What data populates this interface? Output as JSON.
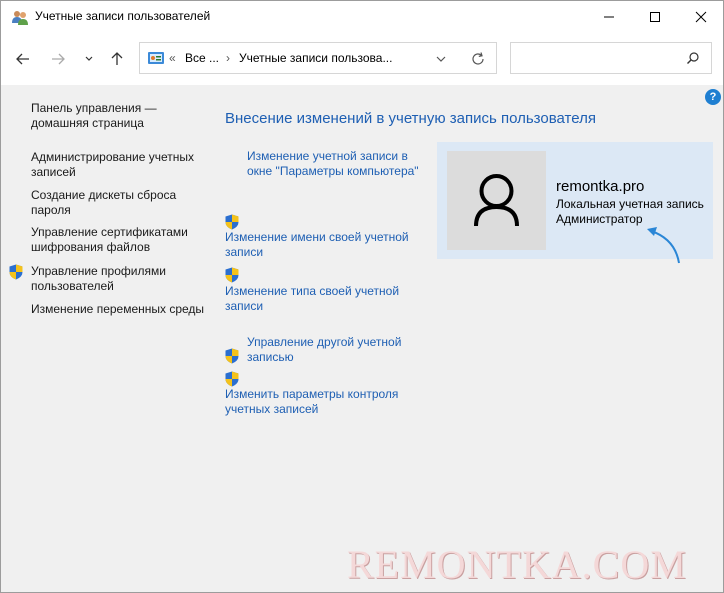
{
  "window": {
    "title": "Учетные записи пользователей"
  },
  "navbar": {
    "address": {
      "overflow": "«",
      "crumb1": "Все ...",
      "crumb2": "Учетные записи пользова..."
    },
    "search_placeholder": ""
  },
  "help": "?",
  "sidebar": {
    "items": [
      {
        "label": "Панель управления — домашняя страница",
        "shield": false
      },
      {
        "label": "Администрирование учетных записей",
        "shield": false
      },
      {
        "label": "Создание дискеты сброса пароля",
        "shield": false
      },
      {
        "label": "Управление сертификатами шифрования файлов",
        "shield": false
      },
      {
        "label": "Управление профилями пользователей",
        "shield": true
      },
      {
        "label": "Изменение переменных среды",
        "shield": false
      }
    ]
  },
  "main": {
    "heading": "Внесение изменений в учетную запись пользователя",
    "tasks": [
      {
        "label": "Изменение учетной записи в окне \"Параметры компьютера\"",
        "shield": false
      },
      {
        "label": "Изменение имени своей учетной записи",
        "shield": true
      },
      {
        "label": "Изменение типа своей учетной записи",
        "shield": true
      },
      {
        "label": "Управление другой учетной записью",
        "shield": true
      },
      {
        "label": "Изменить параметры контроля учетных записей",
        "shield": true
      }
    ]
  },
  "user": {
    "name": "remontka.pro",
    "account_type": "Локальная учетная запись",
    "role": "Администратор"
  },
  "watermark": "REMONTKA.COM",
  "colors": {
    "link": "#1e5fb3",
    "card": "#dce8f5",
    "arrow": "#2a86d6"
  }
}
